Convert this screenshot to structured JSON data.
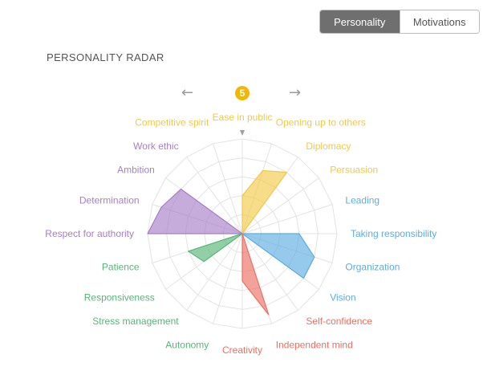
{
  "toggle": {
    "tabs": [
      {
        "label": "Personality",
        "active": true
      },
      {
        "label": "Motivations",
        "active": false
      }
    ]
  },
  "section_title": "PERSONALITY RADAR",
  "nav": {
    "prev_icon": "←",
    "next_icon": "→",
    "indicator_value": "5"
  },
  "colors": {
    "yellow": "#f2c94c",
    "blue": "#5dade2",
    "red": "#ec7063",
    "green": "#58b677",
    "purple": "#a77fc7",
    "grid": "#e3e3e3",
    "pointer": "#9e9e9e",
    "badge": "#f2b705"
  },
  "chart_data": {
    "type": "radar",
    "title": "",
    "scale": {
      "min": 0,
      "max": 10,
      "rings": 5
    },
    "axes": [
      {
        "label": "Ease in public",
        "value": 4,
        "group": "yellow"
      },
      {
        "label": "Opening up to others",
        "value": 7,
        "group": "yellow"
      },
      {
        "label": "Diplomacy",
        "value": 8,
        "group": "yellow"
      },
      {
        "label": "Persuasion",
        "value": 0,
        "group": "yellow"
      },
      {
        "label": "Leading",
        "value": 0,
        "group": "blue"
      },
      {
        "label": "Taking responsibility",
        "value": 6,
        "group": "blue"
      },
      {
        "label": "Organization",
        "value": 8,
        "group": "blue"
      },
      {
        "label": "Vision",
        "value": 8,
        "group": "blue"
      },
      {
        "label": "Self-confidence",
        "value": 0,
        "group": "red"
      },
      {
        "label": "Independent mind",
        "value": 9,
        "group": "red"
      },
      {
        "label": "Creativity",
        "value": 5,
        "group": "red"
      },
      {
        "label": "Autonomy",
        "value": 0,
        "group": "green"
      },
      {
        "label": "Stress management",
        "value": 0,
        "group": "green"
      },
      {
        "label": "Responsiveness",
        "value": 5,
        "group": "green"
      },
      {
        "label": "Patience",
        "value": 6,
        "group": "green"
      },
      {
        "label": "Respect for authority",
        "value": 10,
        "group": "purple"
      },
      {
        "label": "Determination",
        "value": 9,
        "group": "purple"
      },
      {
        "label": "Ambition",
        "value": 8,
        "group": "purple"
      },
      {
        "label": "Work ethic",
        "value": 0,
        "group": "purple"
      },
      {
        "label": "Competitive spirit",
        "value": 0,
        "group": "yellow"
      }
    ],
    "polygons": [
      {
        "group": "yellow",
        "axes": [
          "Ease in public",
          "Opening up to others",
          "Diplomacy",
          "Persuasion",
          "Competitive spirit"
        ]
      },
      {
        "group": "blue",
        "axes": [
          "Leading",
          "Taking responsibility",
          "Organization",
          "Vision"
        ]
      },
      {
        "group": "red",
        "axes": [
          "Self-confidence",
          "Independent mind",
          "Creativity"
        ]
      },
      {
        "group": "green",
        "axes": [
          "Autonomy",
          "Stress management",
          "Responsiveness",
          "Patience"
        ]
      },
      {
        "group": "purple",
        "axes": [
          "Respect for authority",
          "Determination",
          "Ambition",
          "Work ethic"
        ]
      }
    ],
    "grid": true,
    "legend": "none"
  }
}
